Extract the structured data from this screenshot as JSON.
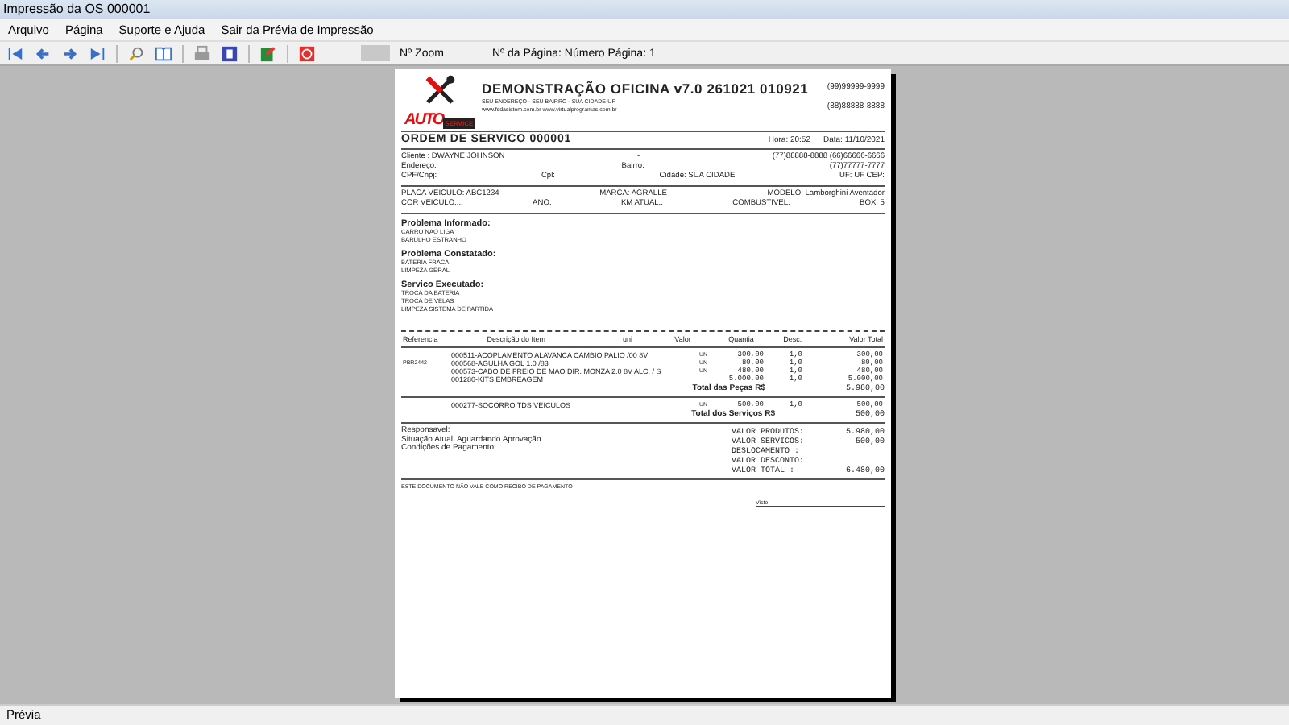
{
  "window": {
    "title": "Impressão da OS 000001"
  },
  "menu": [
    "Arquivo",
    "Página",
    "Suporte e Ajuda",
    "Sair da Prévia de Impressão"
  ],
  "toolbar": {
    "zoom_label": "Nº Zoom",
    "page_label": "Nº da Página: Número Página: 1"
  },
  "document": {
    "logo": {
      "word_1": "AUTO",
      "word_2": "SERVICE"
    },
    "company": "DEMONSTRAÇÃO OFICINA v7.0 261021 010921",
    "address": "SEU ENDEREÇO - SEU BAIRRO - SUA CIDADE-UF",
    "web": "www.fsdasistem.com.br  www.virtualprogramas.com.br",
    "phones": [
      "(99)99999-9999",
      "(88)88888-8888"
    ],
    "os_title": "ORDEM DE SERVICO 000001",
    "time": "Hora: 20:52",
    "date": "Data: 11/10/2021",
    "client_rows": [
      [
        "Cliente   : DWAYNE JOHNSON",
        "-",
        "(77)88888-8888  (66)66666-6666"
      ],
      [
        "Endereço:",
        "Bairro:",
        "(77)77777-7777"
      ],
      [
        "CPF/Cnpj:",
        "Cpl:",
        "Cidade: SUA CIDADE",
        "UF: UF  CEP:"
      ]
    ],
    "vehicle_rows": [
      [
        "PLACA VEICULO: ABC1234",
        "MARCA: AGRALLE",
        "MODELO: Lamborghini Aventador"
      ],
      [
        "COR VEICULO...:",
        "ANO:",
        "KM ATUAL.:",
        "COMBUSTIVEL:",
        "BOX: 5"
      ]
    ],
    "sections": [
      {
        "title": "Problema Informado:",
        "lines": [
          "CARRO NAO LIGA",
          "BARULHO ESTRANHO"
        ]
      },
      {
        "title": "Problema Constatado:",
        "lines": [
          "BATERIA FRACA",
          "LIMPEZA GERAL"
        ]
      },
      {
        "title": "Servico Executado:",
        "lines": [
          "TROCA DA BATERIA",
          "TROCA DE VELAS",
          "LIMPEZA SISTEMA DE PARTIDA"
        ]
      }
    ],
    "columns": [
      "Referencia",
      "Descrição do Item",
      "uni",
      "Valor",
      "Quantia",
      "Desc.",
      "Valor Total"
    ],
    "parts": [
      {
        "desc": "000511-ACOPLAMENTO ALAVANCA CAMBIO  PALIO /00 8V",
        "uni": "UN",
        "valor": "300,00",
        "qty": "1,0",
        "total": "300,00"
      },
      {
        "ref": "PBR2442",
        "desc": "000568-AGULHA GOL 1.0 /83",
        "uni": "UN",
        "valor": "80,00",
        "qty": "1,0",
        "total": "80,00"
      },
      {
        "desc": "000573-CABO DE FREIO DE MAO DIR. MONZA 2.0 8V ALC. / S",
        "uni": "UN",
        "valor": "480,00",
        "qty": "1,0",
        "total": "480,00"
      },
      {
        "desc": "001280-KITS EMBREAGEM",
        "valor": "5.000,00",
        "qty": "1,0",
        "total": "5.000,00"
      }
    ],
    "parts_total_label": "Total das Peças R$",
    "parts_total": "5.980,00",
    "services": [
      {
        "desc": "000277-SOCORRO  TDS VEICULOS",
        "uni": "UN",
        "valor": "500,00",
        "qty": "1,0",
        "total": "500,00"
      }
    ],
    "services_total_label": "Total dos Serviços R$",
    "services_total": "500,00",
    "notes": [
      "Responsavel:",
      "Situação Atual: Aguardando Aprovação",
      "Condições de Pagamento:"
    ],
    "summary": [
      {
        "label": "VALOR PRODUTOS:",
        "value": "5.980,00"
      },
      {
        "label": "VALOR SERVICOS:",
        "value": "500,00"
      },
      {
        "label": "DESLOCAMENTO   :"
      },
      {
        "label": "VALOR DESCONTO:"
      },
      {
        "label": "VALOR TOTAL    :",
        "value": "6.480,00"
      }
    ],
    "disclaimer": "ESTE DOCUMENTO NÃO VALE COMO RECIBO DE PAGAMENTO",
    "signature": "Visto"
  },
  "status_bar": "Prévia"
}
